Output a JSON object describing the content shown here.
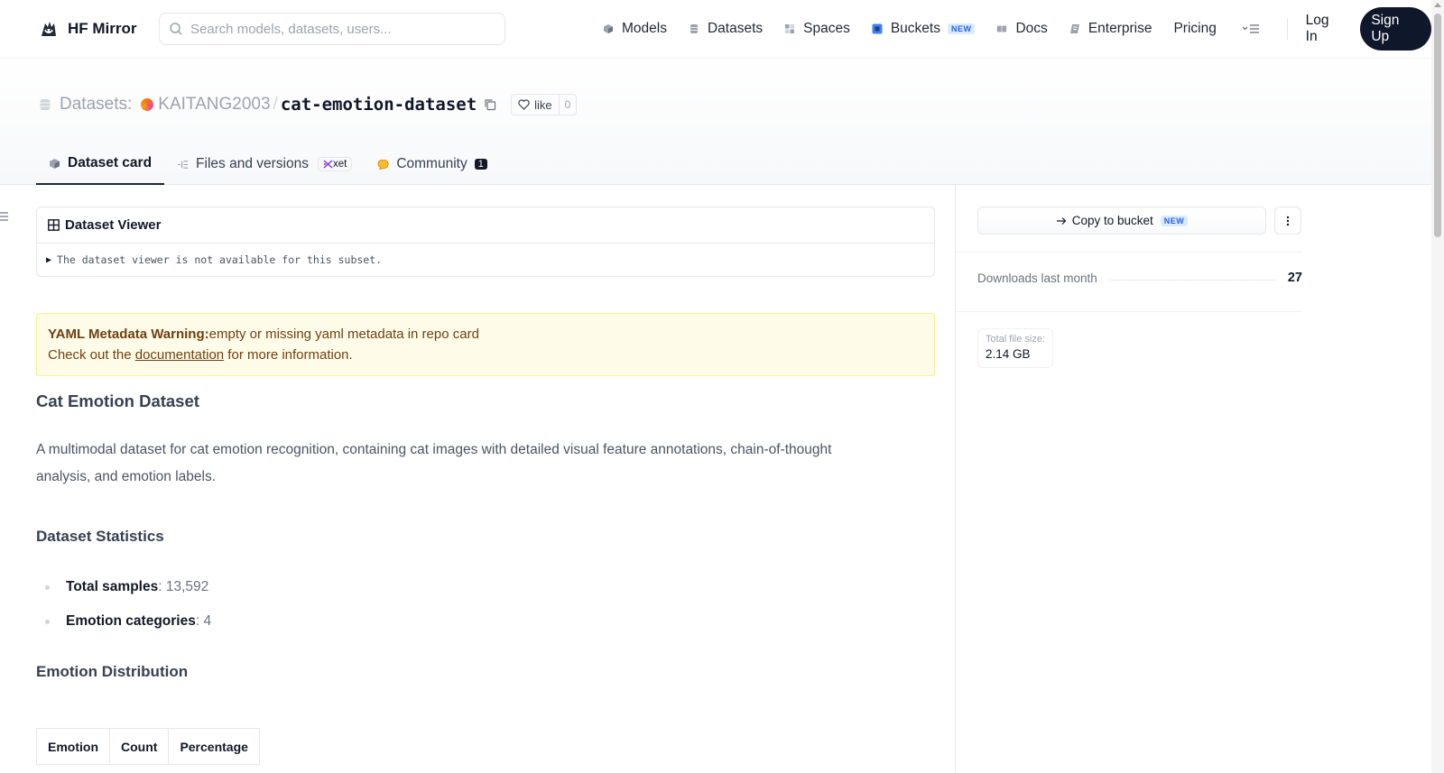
{
  "nav": {
    "brand": "HF Mirror",
    "search_placeholder": "Search models, datasets, users...",
    "items": [
      {
        "label": "Models",
        "icon": "cube-icon"
      },
      {
        "label": "Datasets",
        "icon": "database-icon"
      },
      {
        "label": "Spaces",
        "icon": "grid-icon"
      },
      {
        "label": "Buckets",
        "icon": "bucket-icon",
        "badge": "NEW"
      },
      {
        "label": "Docs",
        "icon": "book-icon"
      },
      {
        "label": "Enterprise",
        "icon": "enterprise-icon"
      },
      {
        "label": "Pricing"
      }
    ],
    "login": "Log In",
    "signup": "Sign Up"
  },
  "header": {
    "section": "Datasets:",
    "org": "KAITANG2003",
    "repo": "cat-emotion-dataset",
    "like_label": "like",
    "like_count": "0"
  },
  "tabs": [
    {
      "label": "Dataset card",
      "active": true
    },
    {
      "label": "Files and versions",
      "badge": "xet"
    },
    {
      "label": "Community",
      "count": "1"
    }
  ],
  "viewer": {
    "title": "Dataset Viewer",
    "message": "The dataset viewer is not available for this subset."
  },
  "warning": {
    "title": "YAML Metadata Warning:",
    "text": "empty or missing yaml metadata in repo card",
    "line2_pre": "Check out the ",
    "link": "documentation",
    "line2_post": " for more information."
  },
  "card": {
    "title": "Cat Emotion Dataset",
    "description": "A multimodal dataset for cat emotion recognition, containing cat images with detailed visual feature annotations, chain-of-thought analysis, and emotion labels.",
    "stats_heading": "Dataset Statistics",
    "stats": [
      {
        "label": "Total samples",
        "value": ": 13,592"
      },
      {
        "label": "Emotion categories",
        "value": ": 4"
      }
    ],
    "dist_heading": "Emotion Distribution",
    "table_headers": [
      "Emotion",
      "Count",
      "Percentage"
    ]
  },
  "sidebar": {
    "copy_button": "Copy to bucket",
    "copy_badge": "NEW",
    "downloads_label": "Downloads last month",
    "downloads_value": "27",
    "filesize_label": "Total file size:",
    "filesize_value": "2.14 GB"
  },
  "colors": {
    "accent": "#0f172a",
    "warning_bg": "#fefce8",
    "warning_text": "#713f12",
    "new_badge": "#2563eb"
  }
}
